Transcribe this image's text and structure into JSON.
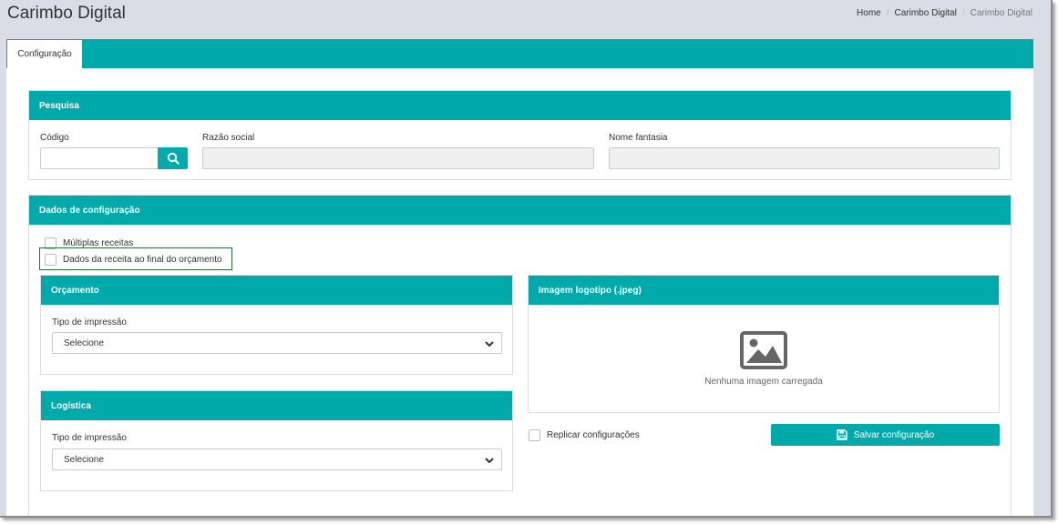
{
  "header": {
    "title": "Carimbo Digital",
    "breadcrumb": [
      "Home",
      "Carimbo Digital",
      "Carimbo Digital"
    ]
  },
  "tabs": [
    {
      "label": "Configuração",
      "active": true
    }
  ],
  "pesquisa": {
    "title": "Pesquisa",
    "codigo_label": "Código",
    "codigo_value": "",
    "razao_label": "Razão social",
    "razao_value": "",
    "fantasia_label": "Nome fantasia",
    "fantasia_value": ""
  },
  "dados": {
    "title": "Dados de configuração",
    "multiplas_label": "Múltiplas receitas",
    "multiplas_checked": false,
    "dados_receita_label": "Dados da receita ao final do orçamento",
    "dados_receita_checked": false
  },
  "orcamento": {
    "title": "Orçamento",
    "tipo_label": "Tipo de impressão",
    "tipo_value": "Selecione"
  },
  "logistica": {
    "title": "Logística",
    "tipo_label": "Tipo de impressão",
    "tipo_value": "Selecione"
  },
  "logotipo": {
    "title": "Imagem logotipo (.jpeg)",
    "placeholder_text": "Nenhuma imagem carregada",
    "icon": "image-icon"
  },
  "replicar_label": "Replicar configurações",
  "replicar_checked": false,
  "save_label": "Salvar configuração",
  "colors": {
    "accent": "#00aaaa",
    "background": "#d9dde6",
    "highlight_border": "#2e6b3a"
  }
}
